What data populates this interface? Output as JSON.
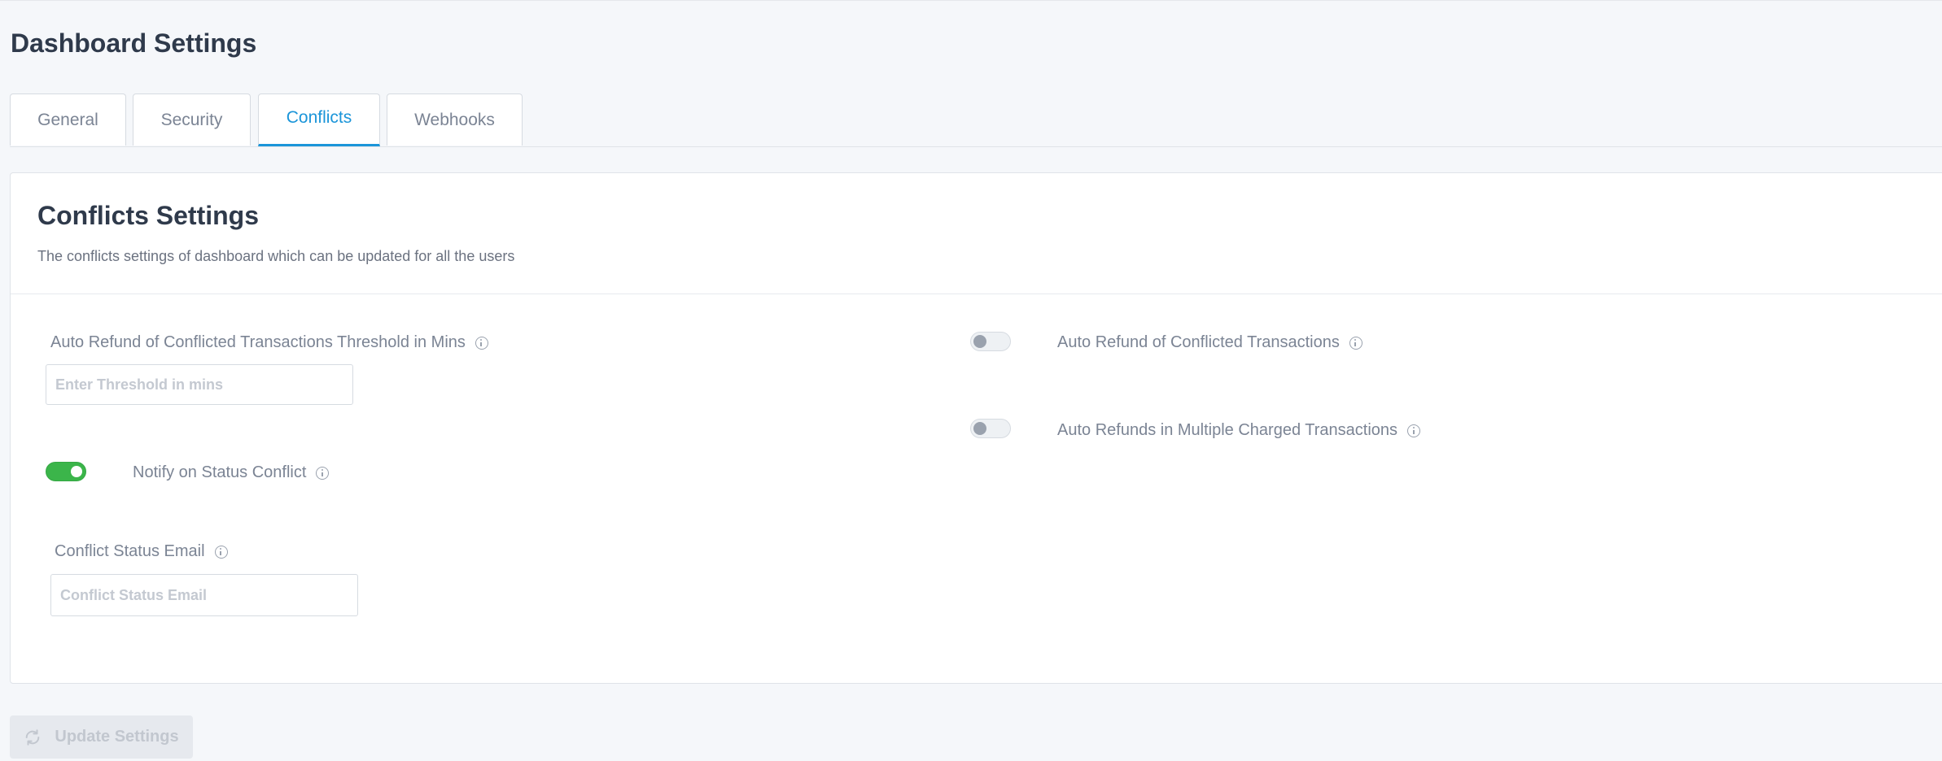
{
  "page": {
    "title": "Dashboard Settings"
  },
  "tabs": [
    {
      "label": "General",
      "active": false
    },
    {
      "label": "Security",
      "active": false
    },
    {
      "label": "Conflicts",
      "active": true
    },
    {
      "label": "Webhooks",
      "active": false
    }
  ],
  "panel": {
    "title": "Conflicts Settings",
    "description": "The conflicts settings of dashboard which can be updated for all the users"
  },
  "fields": {
    "threshold": {
      "label": "Auto Refund of Conflicted Transactions Threshold in Mins",
      "placeholder": "Enter Threshold in mins",
      "value": ""
    },
    "auto_refund": {
      "label": "Auto Refund of Conflicted Transactions",
      "enabled": false
    },
    "multi_charged": {
      "label": "Auto Refunds in Multiple Charged Transactions",
      "enabled": false
    },
    "notify": {
      "label": "Notify on Status Conflict",
      "enabled": true
    },
    "email": {
      "label": "Conflict Status Email",
      "placeholder": "Conflict Status Email",
      "value": ""
    }
  },
  "actions": {
    "update_label": "Update Settings",
    "disabled": true
  },
  "colors": {
    "accent": "#1b95d9",
    "toggle_on": "#3bb54a",
    "title": "#2f3a4b"
  }
}
